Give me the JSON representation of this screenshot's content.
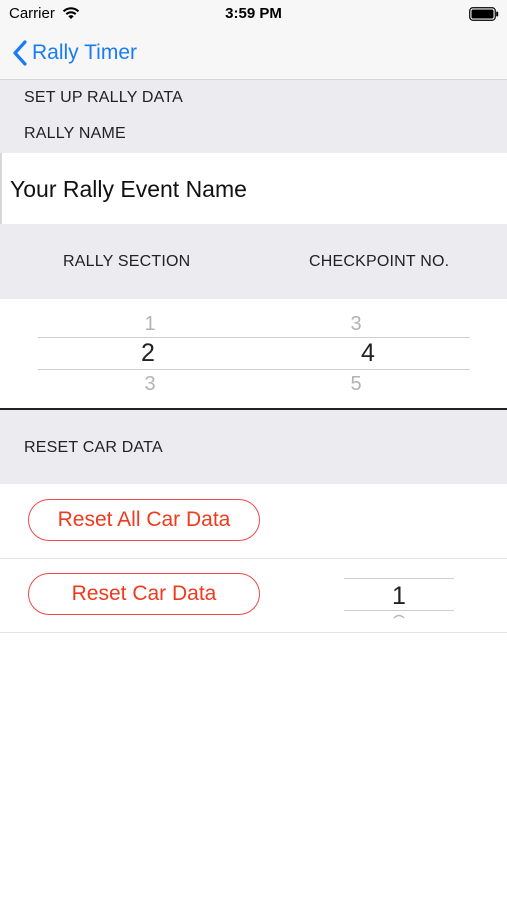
{
  "status_bar": {
    "carrier": "Carrier",
    "time": "3:59 PM"
  },
  "nav": {
    "back_label": "Rally Timer"
  },
  "setup_header": "SET UP RALLY DATA",
  "rally_name_header": "RALLY NAME",
  "rally_name_value": "Your Rally Event Name",
  "columns_header": {
    "rally_section": "RALLY SECTION",
    "checkpoint_no": "CHECKPOINT NO."
  },
  "rally_section_picker": {
    "prev": "1",
    "selected": "2",
    "next": "3"
  },
  "checkpoint_picker": {
    "prev": "3",
    "selected": "4",
    "next": "5"
  },
  "reset_header": "RESET CAR DATA",
  "reset_all_button": "Reset All Car Data",
  "reset_car_button": "Reset Car Data",
  "car_picker": {
    "selected": "1"
  },
  "colors": {
    "accent": "#1a7cf5",
    "destructive": "#ef3a1e",
    "group_bg": "#ebebf0"
  }
}
